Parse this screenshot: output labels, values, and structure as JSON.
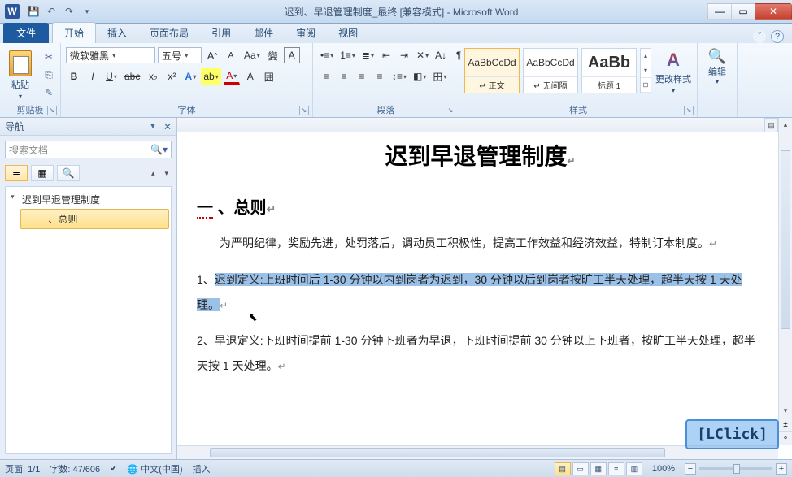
{
  "title": "迟到、早退管理制度_最终 [兼容模式] - Microsoft Word",
  "qat": {
    "save": "💾",
    "undo": "↶",
    "redo": "↷"
  },
  "tabs": {
    "file": "文件",
    "home": "开始",
    "insert": "插入",
    "layout": "页面布局",
    "references": "引用",
    "mailings": "邮件",
    "review": "审阅",
    "view": "视图"
  },
  "ribbon": {
    "clipboard": {
      "label": "剪贴板",
      "paste": "粘贴"
    },
    "font": {
      "label": "字体",
      "family": "微软雅黑",
      "size": "五号",
      "buttons": {
        "growA": "A",
        "shrinkA": "A",
        "clear": "Aa",
        "phonetic": "變",
        "border": "A",
        "bold": "B",
        "italic": "I",
        "underline": "U",
        "strike": "abc",
        "sub": "x₂",
        "sup": "x²",
        "effects": "A",
        "highlight": "ab",
        "fontcolor": "A",
        "charshade": "A",
        "charborder": "囲"
      }
    },
    "paragraph": {
      "label": "段落",
      "buttons": {
        "bullets": "•≡",
        "numbering": "1≡",
        "multilevel": "≣",
        "indentdec": "⇤",
        "indentinc": "⇥",
        "sort": "A↓",
        "marks": "¶",
        "alignl": "≡",
        "alignc": "≡",
        "alignr": "≡",
        "justify": "≡",
        "linespacing": "↕≡",
        "shading": "◧",
        "borders": "田"
      }
    },
    "styles": {
      "label": "样式",
      "items": [
        {
          "preview": "AaBbCcDd",
          "name": "↵ 正文"
        },
        {
          "preview": "AaBbCcDd",
          "name": "↵ 无间隔"
        },
        {
          "preview": "AaBb",
          "name": "标题 1"
        }
      ],
      "change": "更改样式"
    },
    "editing": {
      "label": "编辑",
      "btn": "编辑"
    }
  },
  "nav": {
    "title": "导航",
    "search_placeholder": "搜索文档",
    "tree": [
      {
        "level": 1,
        "text": "迟到早退管理制度"
      },
      {
        "level": 2,
        "text": "一 、总则"
      }
    ]
  },
  "document": {
    "title": "迟到早退管理制度",
    "h2_pre": "一",
    "h2_rest": " 、总则",
    "p1": "为严明纪律，奖励先进，处罚落后，调动员工积极性，提高工作效益和经济效益，特制订本制度。",
    "p2_index": "1、",
    "p2_sel": "迟到定义:上班时间后 1-30 分钟以内到岗者为迟到，30 分钟以后到岗者按旷工半天处理，超半天按 1 天处理。",
    "p3": "2、早退定义:下班时间提前 1-30 分钟下班者为早退，下班时间提前 30 分钟以上下班者，按旷工半天处理，超半天按 1 天处理。"
  },
  "status": {
    "page": "页面: 1/1",
    "words": "字数: 47/606",
    "lang": "中文(中国)",
    "mode": "插入",
    "zoom": "100%",
    "zoomplus": "+",
    "zoomminus": "−",
    "lang_icon": "🌐"
  },
  "overlay": "[LClick]"
}
